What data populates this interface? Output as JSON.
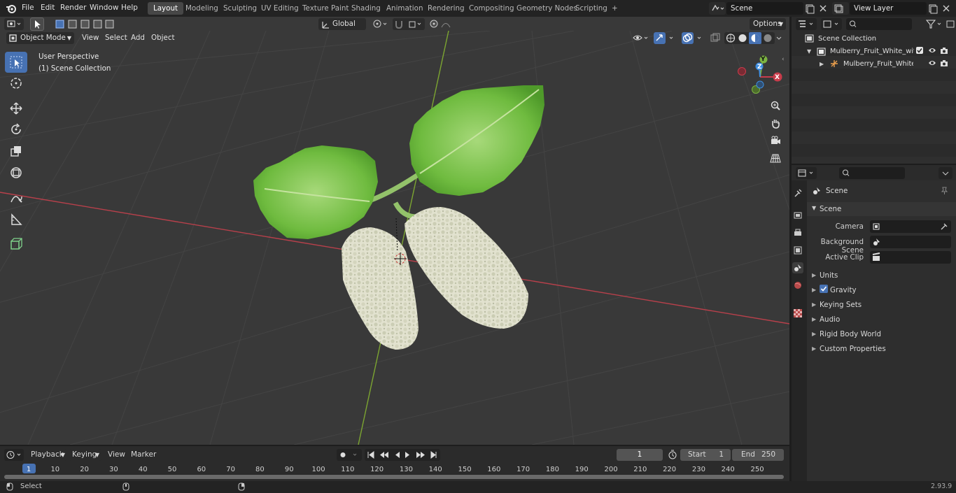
{
  "topbar": {
    "menus": [
      "File",
      "Edit",
      "Render",
      "Window",
      "Help"
    ],
    "workspaces": [
      "Layout",
      "Modeling",
      "Sculpting",
      "UV Editing",
      "Texture Paint",
      "Shading",
      "Animation",
      "Rendering",
      "Compositing",
      "Geometry Nodes",
      "Scripting"
    ],
    "add_tab": "+",
    "scene": "Scene",
    "view_layer": "View Layer"
  },
  "viewport": {
    "mode": "Object Mode",
    "menus": [
      "View",
      "Select",
      "Add",
      "Object"
    ],
    "transform_orientation": "Global",
    "options": "Options",
    "overlay_title": "User Perspective",
    "overlay_collection": "(1) Scene Collection",
    "gizmo": {
      "x": "X",
      "y": "Y",
      "z": "Z"
    }
  },
  "outliner": {
    "root": "Scene Collection",
    "items": [
      {
        "label": "Mulberry_Fruit_White_with_Le"
      },
      {
        "label": "Mulberry_Fruit_White_wit"
      }
    ]
  },
  "properties": {
    "header": "Scene",
    "panel": "Scene",
    "fields": [
      {
        "label": "Camera"
      },
      {
        "label": "Background Scene"
      },
      {
        "label": "Active Clip"
      }
    ],
    "sections": [
      "Units",
      "Gravity",
      "Keying Sets",
      "Audio",
      "Rigid Body World",
      "Custom Properties"
    ],
    "gravity_checked": true
  },
  "timeline": {
    "menus": [
      "Playback",
      "Keying",
      "View",
      "Marker"
    ],
    "current_frame": "1",
    "start_label": "Start",
    "start": "1",
    "end_label": "End",
    "end": "250",
    "ticks": [
      "1",
      "10",
      "20",
      "30",
      "40",
      "50",
      "60",
      "70",
      "80",
      "90",
      "100",
      "110",
      "120",
      "130",
      "140",
      "150",
      "160",
      "170",
      "180",
      "190",
      "200",
      "210",
      "220",
      "230",
      "240",
      "250"
    ]
  },
  "status": {
    "left": "Select",
    "version": "2.93.9"
  },
  "colors": {
    "accent": "#4772b3",
    "x_axis": "#c93c4b",
    "y_axis": "#7cb342",
    "z_axis": "#3d8de0"
  }
}
